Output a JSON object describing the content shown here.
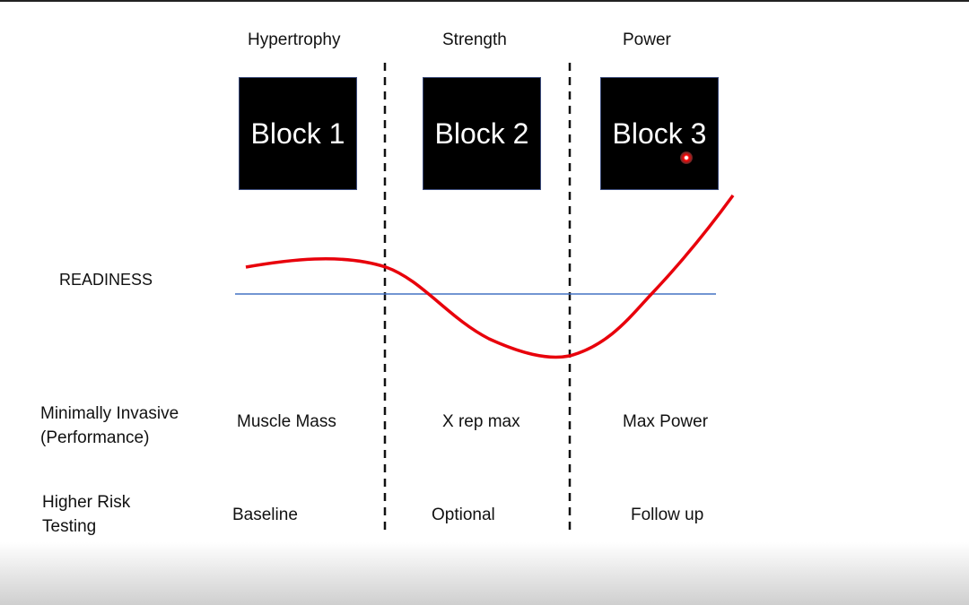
{
  "columns": [
    {
      "phase": "Hypertrophy",
      "block": "Block 1",
      "performance": "Muscle Mass",
      "testing": "Baseline"
    },
    {
      "phase": "Strength",
      "block": "Block 2",
      "performance": "X rep max",
      "testing": "Optional"
    },
    {
      "phase": "Power",
      "block": "Block 3",
      "performance": "Max Power",
      "testing": "Follow up"
    }
  ],
  "rows": {
    "readiness": "READINESS",
    "performance_line1": "Minimally Invasive",
    "performance_line2": "(Performance)",
    "testing_line1": "Higher Risk",
    "testing_line2": "Testing"
  },
  "colors": {
    "curve": "#e8000b",
    "baseline": "#4472c4",
    "block": "#000000"
  }
}
